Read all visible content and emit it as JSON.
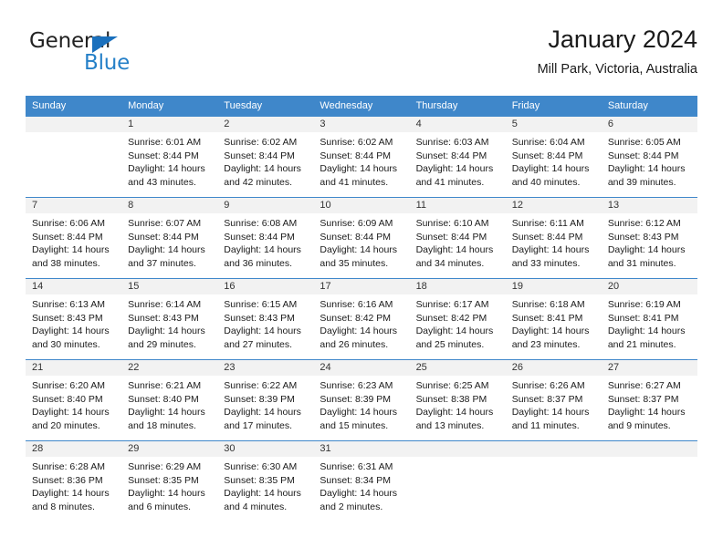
{
  "brand": {
    "name_part1": "General",
    "name_part2": "Blue",
    "accent_color": "#2580c8",
    "triangle_color": "#1a70bd"
  },
  "header": {
    "title": "January 2024",
    "location": "Mill Park, Victoria, Australia"
  },
  "calendar": {
    "header_bg": "#3f87ca",
    "daynum_bg": "#f2f2f2",
    "weekday_headers": [
      "Sunday",
      "Monday",
      "Tuesday",
      "Wednesday",
      "Thursday",
      "Friday",
      "Saturday"
    ],
    "weeks": [
      [
        {
          "day": "",
          "sunrise": "",
          "sunset": "",
          "daylight_l1": "",
          "daylight_l2": ""
        },
        {
          "day": "1",
          "sunrise": "Sunrise: 6:01 AM",
          "sunset": "Sunset: 8:44 PM",
          "daylight_l1": "Daylight: 14 hours",
          "daylight_l2": "and 43 minutes."
        },
        {
          "day": "2",
          "sunrise": "Sunrise: 6:02 AM",
          "sunset": "Sunset: 8:44 PM",
          "daylight_l1": "Daylight: 14 hours",
          "daylight_l2": "and 42 minutes."
        },
        {
          "day": "3",
          "sunrise": "Sunrise: 6:02 AM",
          "sunset": "Sunset: 8:44 PM",
          "daylight_l1": "Daylight: 14 hours",
          "daylight_l2": "and 41 minutes."
        },
        {
          "day": "4",
          "sunrise": "Sunrise: 6:03 AM",
          "sunset": "Sunset: 8:44 PM",
          "daylight_l1": "Daylight: 14 hours",
          "daylight_l2": "and 41 minutes."
        },
        {
          "day": "5",
          "sunrise": "Sunrise: 6:04 AM",
          "sunset": "Sunset: 8:44 PM",
          "daylight_l1": "Daylight: 14 hours",
          "daylight_l2": "and 40 minutes."
        },
        {
          "day": "6",
          "sunrise": "Sunrise: 6:05 AM",
          "sunset": "Sunset: 8:44 PM",
          "daylight_l1": "Daylight: 14 hours",
          "daylight_l2": "and 39 minutes."
        }
      ],
      [
        {
          "day": "7",
          "sunrise": "Sunrise: 6:06 AM",
          "sunset": "Sunset: 8:44 PM",
          "daylight_l1": "Daylight: 14 hours",
          "daylight_l2": "and 38 minutes."
        },
        {
          "day": "8",
          "sunrise": "Sunrise: 6:07 AM",
          "sunset": "Sunset: 8:44 PM",
          "daylight_l1": "Daylight: 14 hours",
          "daylight_l2": "and 37 minutes."
        },
        {
          "day": "9",
          "sunrise": "Sunrise: 6:08 AM",
          "sunset": "Sunset: 8:44 PM",
          "daylight_l1": "Daylight: 14 hours",
          "daylight_l2": "and 36 minutes."
        },
        {
          "day": "10",
          "sunrise": "Sunrise: 6:09 AM",
          "sunset": "Sunset: 8:44 PM",
          "daylight_l1": "Daylight: 14 hours",
          "daylight_l2": "and 35 minutes."
        },
        {
          "day": "11",
          "sunrise": "Sunrise: 6:10 AM",
          "sunset": "Sunset: 8:44 PM",
          "daylight_l1": "Daylight: 14 hours",
          "daylight_l2": "and 34 minutes."
        },
        {
          "day": "12",
          "sunrise": "Sunrise: 6:11 AM",
          "sunset": "Sunset: 8:44 PM",
          "daylight_l1": "Daylight: 14 hours",
          "daylight_l2": "and 33 minutes."
        },
        {
          "day": "13",
          "sunrise": "Sunrise: 6:12 AM",
          "sunset": "Sunset: 8:43 PM",
          "daylight_l1": "Daylight: 14 hours",
          "daylight_l2": "and 31 minutes."
        }
      ],
      [
        {
          "day": "14",
          "sunrise": "Sunrise: 6:13 AM",
          "sunset": "Sunset: 8:43 PM",
          "daylight_l1": "Daylight: 14 hours",
          "daylight_l2": "and 30 minutes."
        },
        {
          "day": "15",
          "sunrise": "Sunrise: 6:14 AM",
          "sunset": "Sunset: 8:43 PM",
          "daylight_l1": "Daylight: 14 hours",
          "daylight_l2": "and 29 minutes."
        },
        {
          "day": "16",
          "sunrise": "Sunrise: 6:15 AM",
          "sunset": "Sunset: 8:43 PM",
          "daylight_l1": "Daylight: 14 hours",
          "daylight_l2": "and 27 minutes."
        },
        {
          "day": "17",
          "sunrise": "Sunrise: 6:16 AM",
          "sunset": "Sunset: 8:42 PM",
          "daylight_l1": "Daylight: 14 hours",
          "daylight_l2": "and 26 minutes."
        },
        {
          "day": "18",
          "sunrise": "Sunrise: 6:17 AM",
          "sunset": "Sunset: 8:42 PM",
          "daylight_l1": "Daylight: 14 hours",
          "daylight_l2": "and 25 minutes."
        },
        {
          "day": "19",
          "sunrise": "Sunrise: 6:18 AM",
          "sunset": "Sunset: 8:41 PM",
          "daylight_l1": "Daylight: 14 hours",
          "daylight_l2": "and 23 minutes."
        },
        {
          "day": "20",
          "sunrise": "Sunrise: 6:19 AM",
          "sunset": "Sunset: 8:41 PM",
          "daylight_l1": "Daylight: 14 hours",
          "daylight_l2": "and 21 minutes."
        }
      ],
      [
        {
          "day": "21",
          "sunrise": "Sunrise: 6:20 AM",
          "sunset": "Sunset: 8:40 PM",
          "daylight_l1": "Daylight: 14 hours",
          "daylight_l2": "and 20 minutes."
        },
        {
          "day": "22",
          "sunrise": "Sunrise: 6:21 AM",
          "sunset": "Sunset: 8:40 PM",
          "daylight_l1": "Daylight: 14 hours",
          "daylight_l2": "and 18 minutes."
        },
        {
          "day": "23",
          "sunrise": "Sunrise: 6:22 AM",
          "sunset": "Sunset: 8:39 PM",
          "daylight_l1": "Daylight: 14 hours",
          "daylight_l2": "and 17 minutes."
        },
        {
          "day": "24",
          "sunrise": "Sunrise: 6:23 AM",
          "sunset": "Sunset: 8:39 PM",
          "daylight_l1": "Daylight: 14 hours",
          "daylight_l2": "and 15 minutes."
        },
        {
          "day": "25",
          "sunrise": "Sunrise: 6:25 AM",
          "sunset": "Sunset: 8:38 PM",
          "daylight_l1": "Daylight: 14 hours",
          "daylight_l2": "and 13 minutes."
        },
        {
          "day": "26",
          "sunrise": "Sunrise: 6:26 AM",
          "sunset": "Sunset: 8:37 PM",
          "daylight_l1": "Daylight: 14 hours",
          "daylight_l2": "and 11 minutes."
        },
        {
          "day": "27",
          "sunrise": "Sunrise: 6:27 AM",
          "sunset": "Sunset: 8:37 PM",
          "daylight_l1": "Daylight: 14 hours",
          "daylight_l2": "and 9 minutes."
        }
      ],
      [
        {
          "day": "28",
          "sunrise": "Sunrise: 6:28 AM",
          "sunset": "Sunset: 8:36 PM",
          "daylight_l1": "Daylight: 14 hours",
          "daylight_l2": "and 8 minutes."
        },
        {
          "day": "29",
          "sunrise": "Sunrise: 6:29 AM",
          "sunset": "Sunset: 8:35 PM",
          "daylight_l1": "Daylight: 14 hours",
          "daylight_l2": "and 6 minutes."
        },
        {
          "day": "30",
          "sunrise": "Sunrise: 6:30 AM",
          "sunset": "Sunset: 8:35 PM",
          "daylight_l1": "Daylight: 14 hours",
          "daylight_l2": "and 4 minutes."
        },
        {
          "day": "31",
          "sunrise": "Sunrise: 6:31 AM",
          "sunset": "Sunset: 8:34 PM",
          "daylight_l1": "Daylight: 14 hours",
          "daylight_l2": "and 2 minutes."
        },
        {
          "day": "",
          "sunrise": "",
          "sunset": "",
          "daylight_l1": "",
          "daylight_l2": ""
        },
        {
          "day": "",
          "sunrise": "",
          "sunset": "",
          "daylight_l1": "",
          "daylight_l2": ""
        },
        {
          "day": "",
          "sunrise": "",
          "sunset": "",
          "daylight_l1": "",
          "daylight_l2": ""
        }
      ]
    ]
  }
}
